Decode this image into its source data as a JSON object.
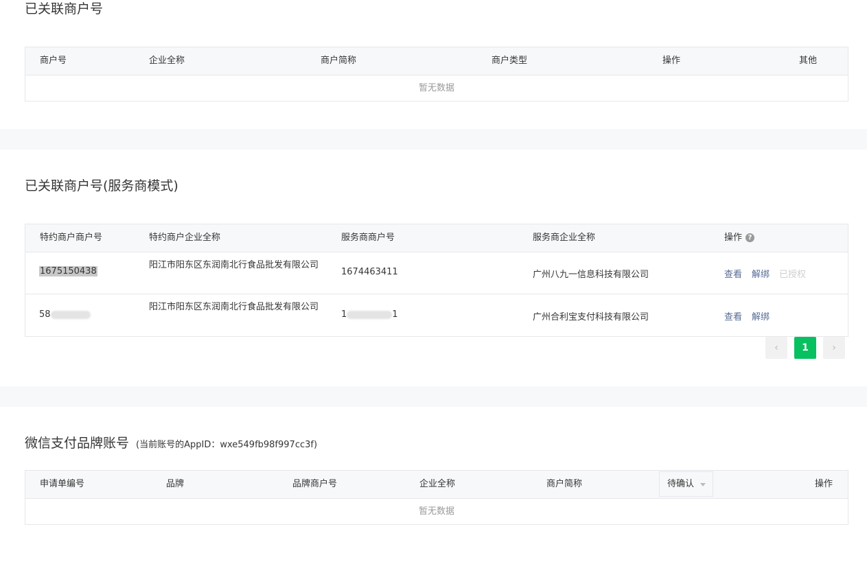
{
  "section1": {
    "title": "已关联商户号",
    "columns": [
      "商户号",
      "企业全称",
      "商户简称",
      "商户类型",
      "操作",
      "其他"
    ],
    "empty_text": "暂无数据"
  },
  "section2": {
    "title": "已关联商户号(服务商模式)",
    "columns": [
      "特约商户商户号",
      "特约商户企业全称",
      "服务商商户号",
      "服务商企业全称",
      "操作"
    ],
    "help_icon": "question-circle-icon",
    "rows": [
      {
        "sub_mch_id": "1675150438",
        "sub_company": "阳江市阳东区东润南北行食品批发有限公司",
        "sp_mch_id": "1674463411",
        "sp_company": "广州八九一信息科技有限公司",
        "action_view": "查看",
        "action_unbind": "解绑",
        "action_authorized": "已授权"
      },
      {
        "sub_mch_id": "58",
        "sub_company": "阳江市阳东区东润南北行食品批发有限公司",
        "sp_mch_id": "1",
        "sp_mch_id_suffix": "1",
        "sp_company": "广州合利宝支付科技有限公司",
        "action_view": "查看",
        "action_unbind": "解绑"
      }
    ],
    "pagination": {
      "prev": "‹",
      "current": "1",
      "next": "›"
    }
  },
  "section3": {
    "title": "微信支付品牌账号",
    "subtitle": "(当前账号的AppID：wxe549fb98f997cc3f)",
    "columns": [
      "申请单编号",
      "品牌",
      "品牌商户号",
      "企业全称",
      "商户简称",
      "操作"
    ],
    "status_filter": "待确认",
    "empty_text": "暂无数据"
  }
}
